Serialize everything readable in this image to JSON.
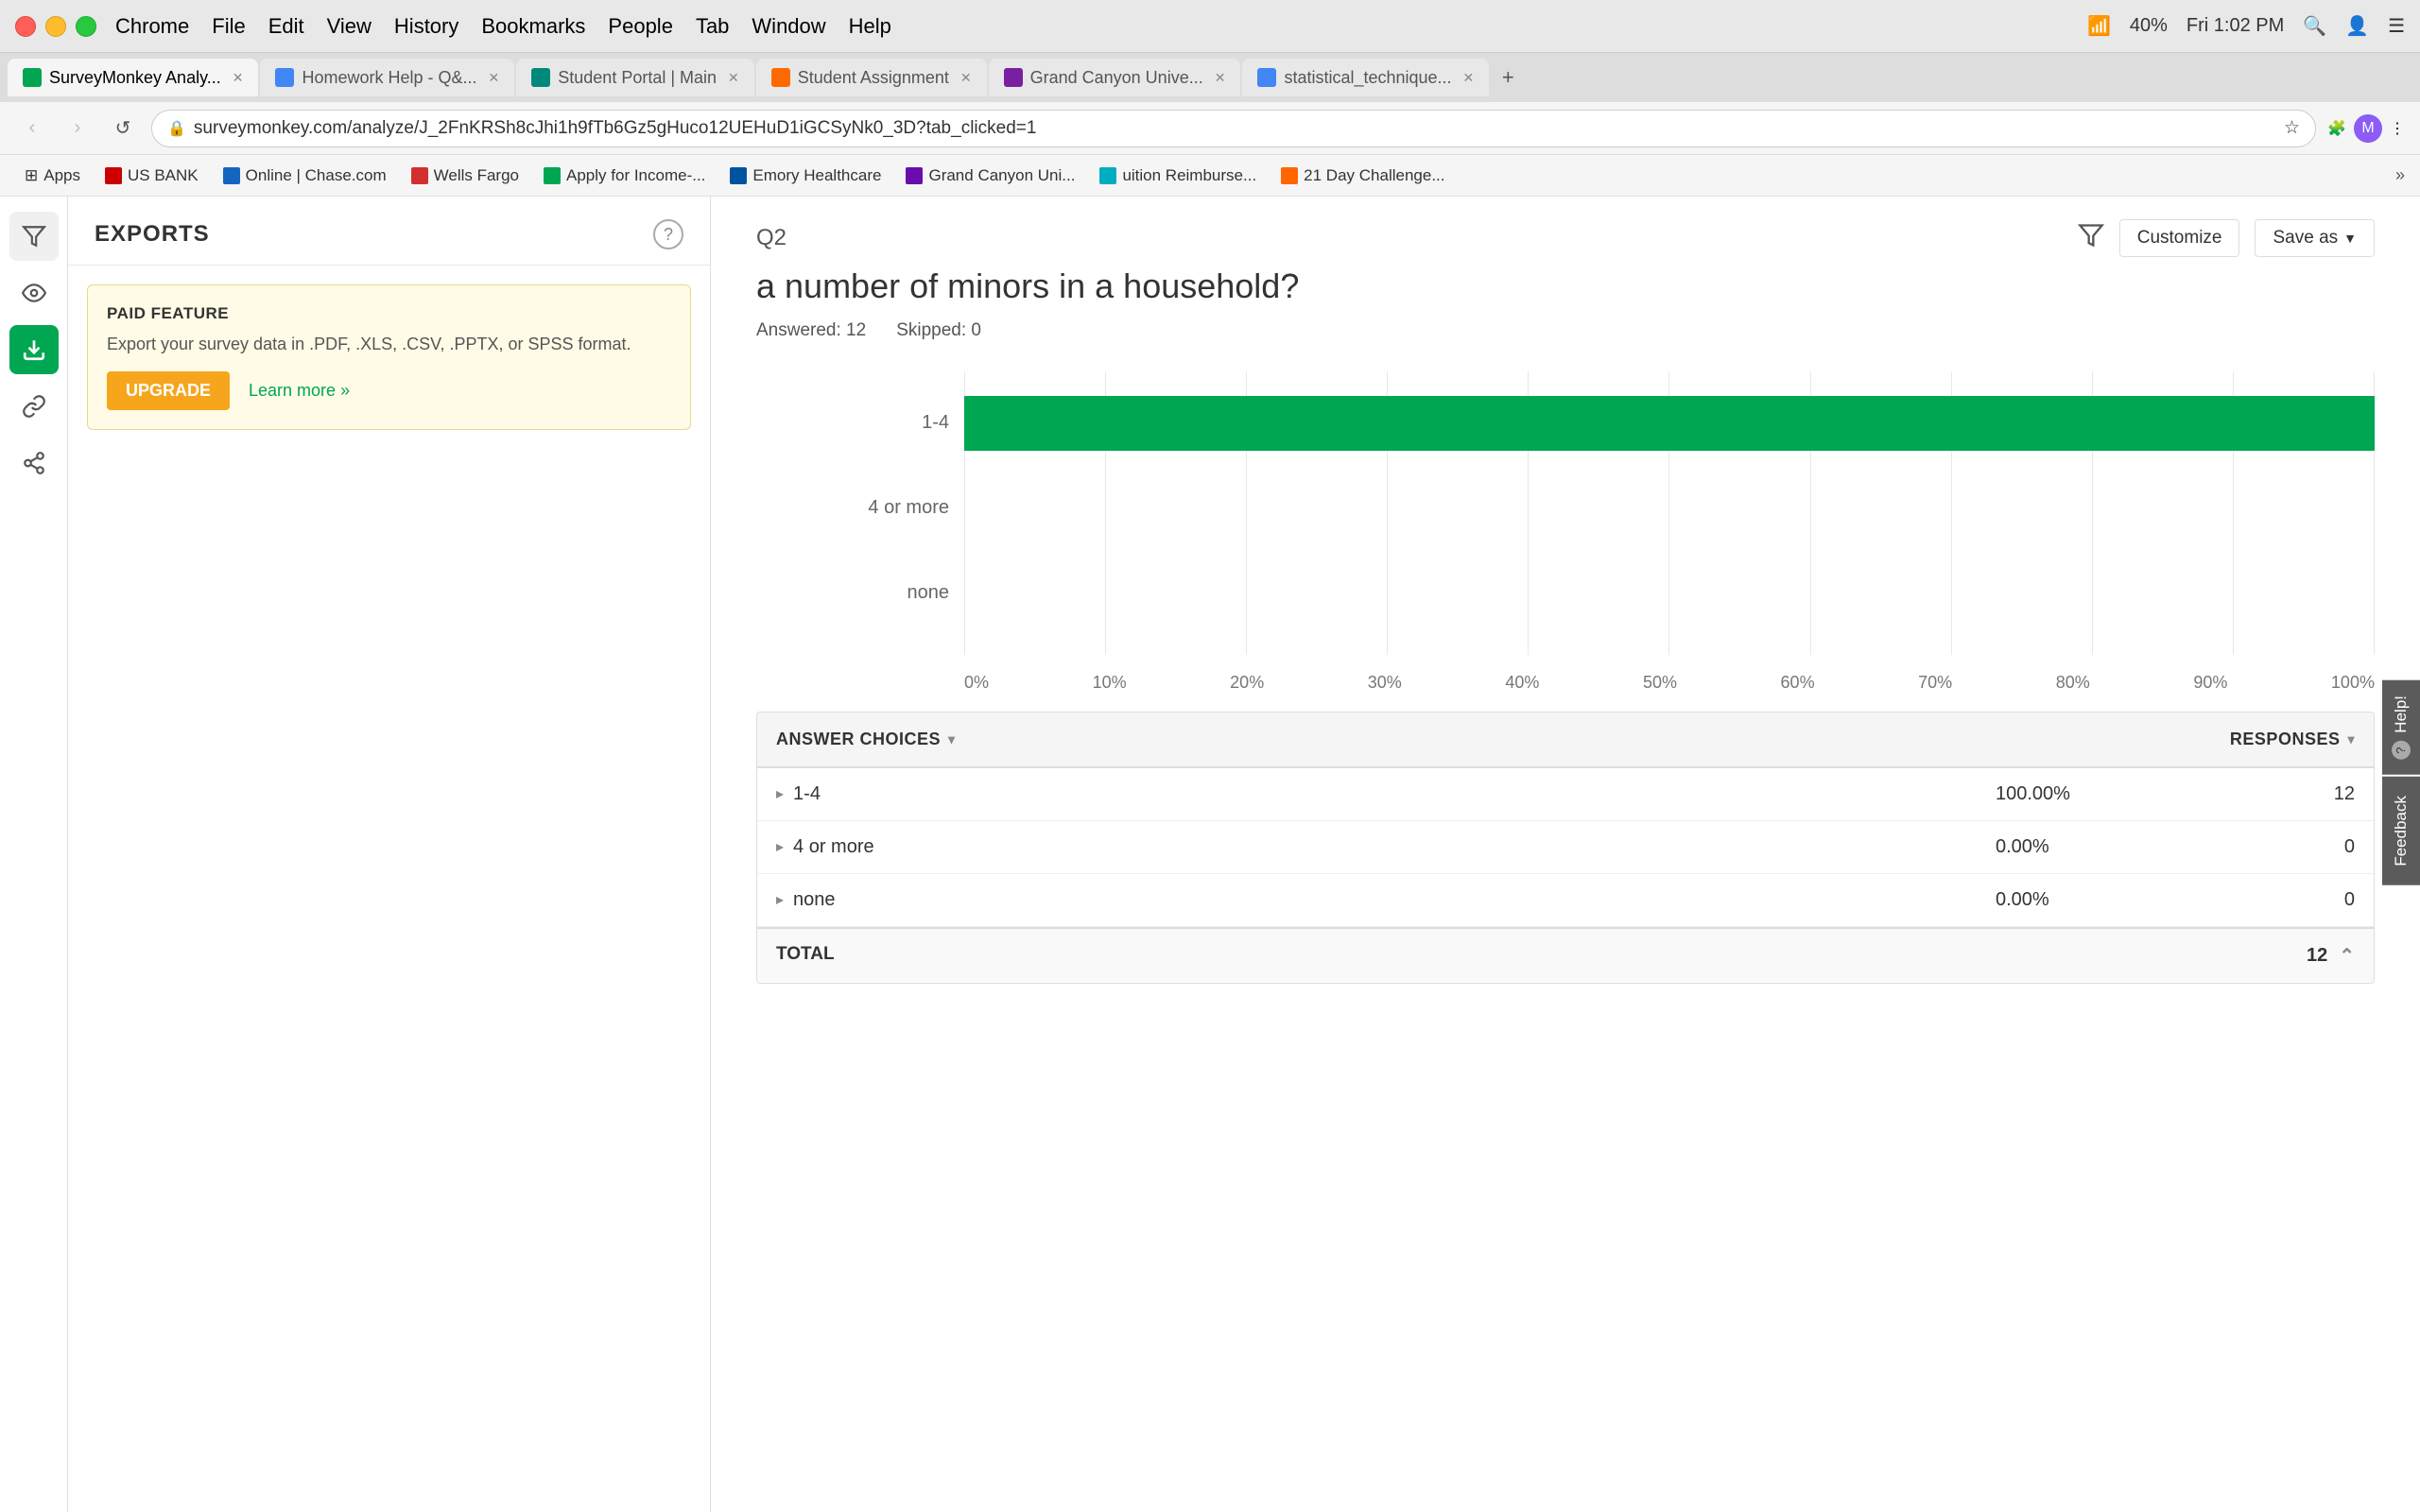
{
  "titleBar": {
    "menus": [
      "Chrome",
      "File",
      "Edit",
      "View",
      "History",
      "Bookmarks",
      "People",
      "Tab",
      "Window",
      "Help"
    ],
    "battery": "40%",
    "time": "Fri 1:02 PM",
    "wifi": "wifi"
  },
  "browser": {
    "tabs": [
      {
        "id": "tab-surveymonkey",
        "label": "SurveyMonkey Analy...",
        "favicon": "sm",
        "active": true
      },
      {
        "id": "tab-homework",
        "label": "Homework Help - Q&...",
        "favicon": "blue",
        "active": false
      },
      {
        "id": "tab-student-portal",
        "label": "Student Portal | Main",
        "favicon": "teal",
        "active": false
      },
      {
        "id": "tab-student-assignment",
        "label": "Student Assignment",
        "favicon": "orange",
        "active": false
      },
      {
        "id": "tab-grand-canyon",
        "label": "Grand Canyon Unive...",
        "favicon": "purple",
        "active": false
      },
      {
        "id": "tab-statistical",
        "label": "statistical_technique...",
        "favicon": "blue",
        "active": false
      }
    ],
    "addressBar": {
      "url": "surveymonkey.com/analyze/J_2FnKRSh8cJhi1h9fTb6Gz5gHuco12UEHuD1iGCSyNk0_3D?tab_clicked=1",
      "secure": true
    },
    "bookmarks": [
      {
        "id": "bm-apps",
        "label": "Apps",
        "favicon": "grid"
      },
      {
        "id": "bm-usbank",
        "label": "US BANK",
        "favicon": "red"
      },
      {
        "id": "bm-chase",
        "label": "Online | Chase.com",
        "favicon": "darkblue"
      },
      {
        "id": "bm-wells",
        "label": "Wells Fargo",
        "favicon": "red"
      },
      {
        "id": "bm-apply",
        "label": "Apply for Income-...",
        "favicon": "green"
      },
      {
        "id": "bm-emory",
        "label": "Emory Healthcare",
        "favicon": "blue"
      },
      {
        "id": "bm-gcu",
        "label": "Grand Canyon Uni...",
        "favicon": "purple"
      },
      {
        "id": "bm-tuition",
        "label": "uition Reimburse...",
        "favicon": "teal"
      },
      {
        "id": "bm-21day",
        "label": "21 Day Challenge...",
        "favicon": "orange"
      }
    ]
  },
  "sidebar": {
    "icons": [
      {
        "id": "icon-filter",
        "symbol": "⚡",
        "label": "filter-icon"
      },
      {
        "id": "icon-eye",
        "symbol": "👁",
        "label": "eye-icon"
      },
      {
        "id": "icon-download",
        "symbol": "↓",
        "label": "download-icon",
        "active": true
      },
      {
        "id": "icon-link",
        "symbol": "🔗",
        "label": "link-icon"
      },
      {
        "id": "icon-share",
        "symbol": "⤴",
        "label": "share-icon"
      }
    ]
  },
  "exportsPanel": {
    "title": "EXPORTS",
    "helpLabel": "?",
    "paidFeature": {
      "label": "PAID FEATURE",
      "description": "Export your survey data in .PDF, .XLS, .CSV, .PPTX, or SPSS format.",
      "upgradeLabel": "UPGRADE",
      "learnMoreLabel": "Learn more »"
    }
  },
  "question": {
    "id": "Q2",
    "title": "a number of minors in a household?",
    "answeredLabel": "Answered: 12",
    "skippedLabel": "Skipped: 0",
    "customizeLabel": "Customize",
    "saveAsLabel": "Save as"
  },
  "chart": {
    "xLabels": [
      "0%",
      "10%",
      "20%",
      "30%",
      "40%",
      "50%",
      "60%",
      "70%",
      "80%",
      "90%",
      "100%"
    ],
    "bars": [
      {
        "label": "1-4",
        "value": 100,
        "color": "#00a651"
      },
      {
        "label": "4 or more",
        "value": 0,
        "color": "#00a651"
      },
      {
        "label": "none",
        "value": 0,
        "color": "#00a651"
      }
    ]
  },
  "table": {
    "headers": {
      "answerChoices": "ANSWER CHOICES",
      "responses": "RESPONSES"
    },
    "rows": [
      {
        "label": "1-4",
        "percent": "100.00%",
        "count": "12"
      },
      {
        "label": "4 or more",
        "percent": "0.00%",
        "count": "0"
      },
      {
        "label": "none",
        "percent": "0.00%",
        "count": "0"
      }
    ],
    "total": {
      "label": "TOTAL",
      "count": "12"
    }
  },
  "rightSidebar": {
    "helpLabel": "Help!",
    "feedbackLabel": "Feedback"
  }
}
